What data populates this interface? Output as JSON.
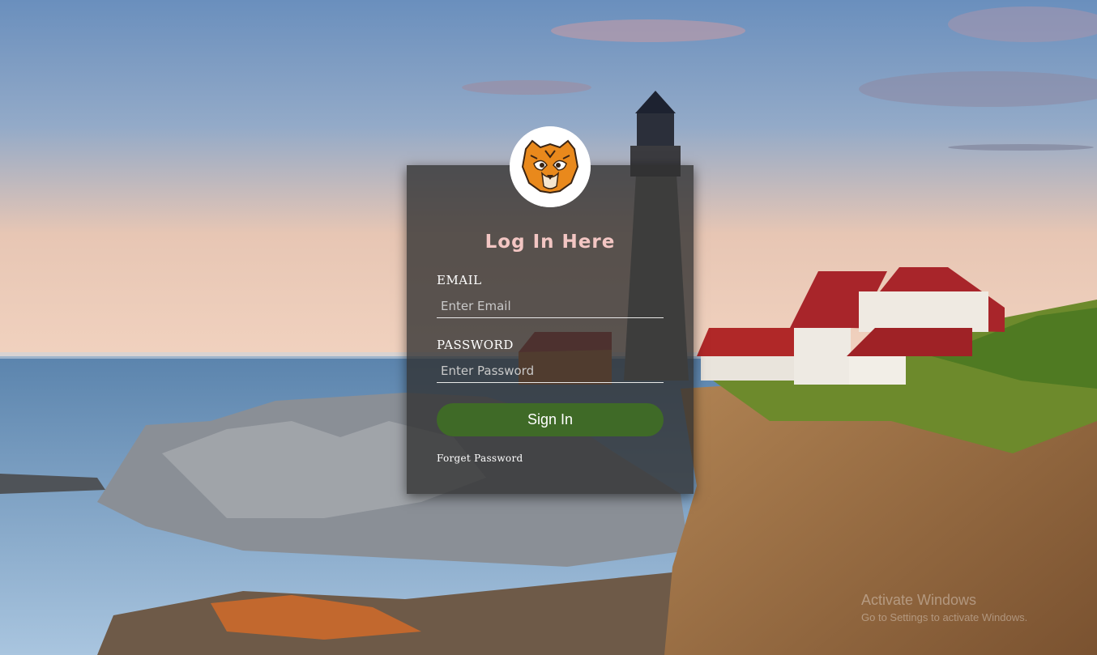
{
  "background": {
    "description_icon": "lighthouse-landscape-image"
  },
  "login": {
    "logo_icon": "tiger-face-logo",
    "title": "Log In Here",
    "email": {
      "label": "EMAIL",
      "placeholder": "Enter Email",
      "value": ""
    },
    "password": {
      "label": "PASSWORD",
      "placeholder": "Enter Password",
      "value": ""
    },
    "submit_label": "Sign In",
    "forget_label": "Forget Password"
  },
  "watermark": {
    "title": "Activate Windows",
    "subtitle": "Go to Settings to activate Windows."
  },
  "colors": {
    "title": "#f3c6c3",
    "button": "#3f6a27",
    "panel": "#303030"
  }
}
